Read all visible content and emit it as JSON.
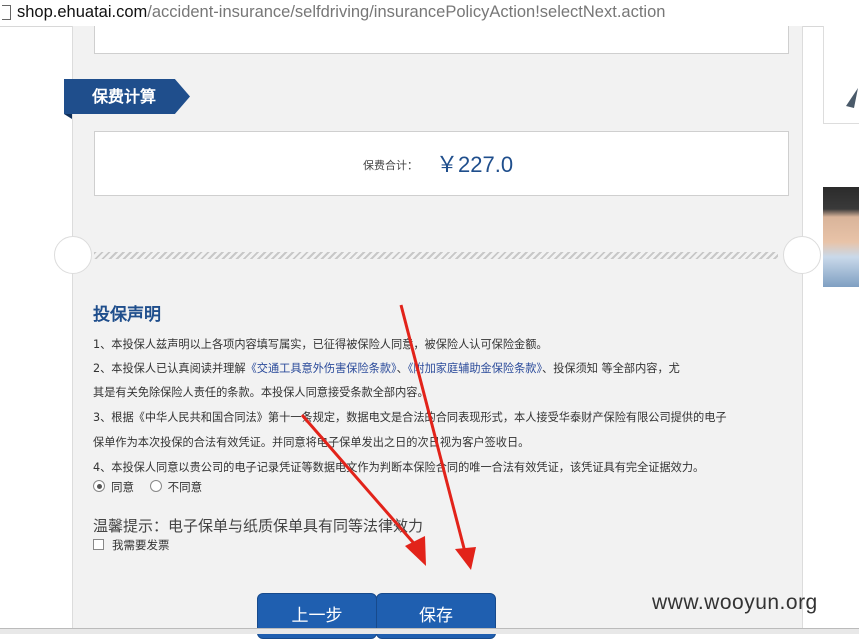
{
  "browser": {
    "url_host": "shop.ehuatai.com",
    "url_path": "/accident-insurance/selfdriving/insurancePolicyAction!selectNext.action"
  },
  "premium_section": {
    "title": "保费计算",
    "total_label": "保费合计：",
    "total_value": "￥227.0"
  },
  "declaration": {
    "title": "投保声明",
    "line1": "1、本投保人兹声明以上各项内容填写属实，已征得被保险人同意，被保险人认可保险金额。",
    "line2_prefix": "2、本投保人已认真阅读并理解",
    "link1": "《交通工具意外伤害保险条款》",
    "separator": "、",
    "link2": "《附加家庭辅助金保险条款》",
    "line2_suffix": "、投保须知 等全部内容，尤",
    "line2_cont": "其是有关免除保险人责任的条款。本投保人同意接受条款全部内容。",
    "line3": "3、根据《中华人民共和国合同法》第十一条规定，数据电文是合法的合同表现形式，本人接受华泰财产保险有限公司提供的电子",
    "line3_cont": "保单作为本次投保的合法有效凭证。并同意将电子保单发出之日的次日视为客户签收日。",
    "line4": "4、本投保人同意以贵公司的电子记录凭证等数据电文作为判断本保险合同的唯一合法有效凭证，该凭证具有完全证据效力。",
    "agree_label": "同意",
    "disagree_label": "不同意",
    "selected": "同意"
  },
  "tip": "温馨提示：电子保单与纸质保单具有同等法律效力",
  "invoice_label": "我需要发票",
  "buttons": {
    "prev": "上一步",
    "save": "保存"
  },
  "watermark": "www.wooyun.org",
  "colors": {
    "brand_blue": "#1f4e8c",
    "button_blue": "#1f5fb0",
    "annotation_red": "#e2231a"
  },
  "icons": [
    "page-icon",
    "radio-icon",
    "checkbox-icon",
    "annotation-arrow"
  ]
}
